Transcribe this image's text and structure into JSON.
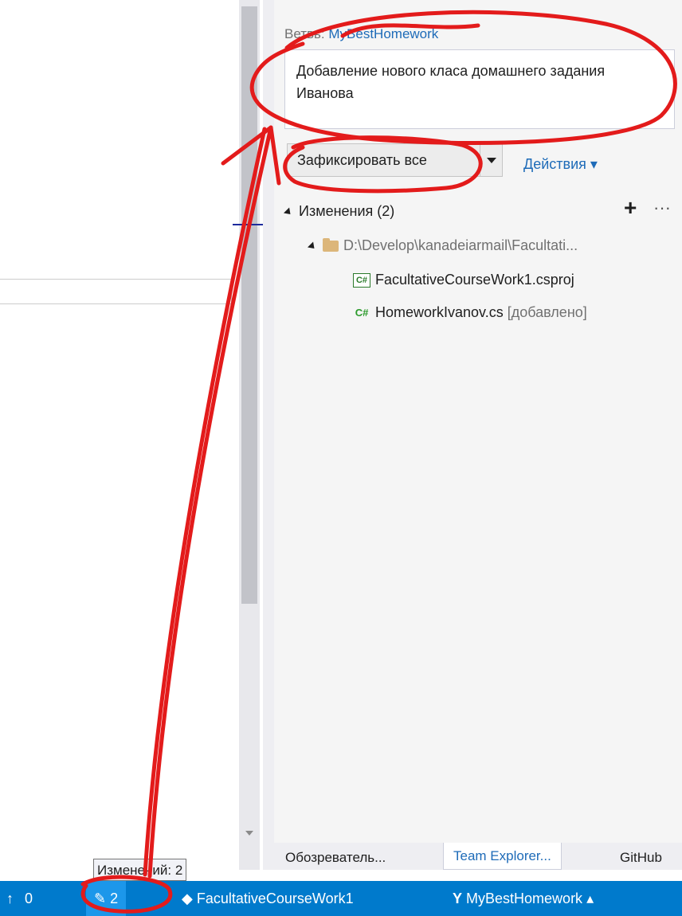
{
  "panel": {
    "branch_label": "Ветвь:",
    "branch_name": "MyBestHomework",
    "commit_message": "Добавление нового класа домашнего задания Иванова",
    "commit_button": "Зафиксировать все",
    "actions_link": "Действия ▾",
    "changes_header": "Изменения (2)",
    "add_symbol": "+",
    "more_symbol": "···",
    "folder_path": "D:\\Develop\\kanadeiarmail\\Facultati...",
    "files": [
      {
        "icon": "C#",
        "name": "FacultativeCourseWork1.csproj",
        "status": ""
      },
      {
        "icon": "C#",
        "name": "HomeworkIvanov.cs",
        "status": "[добавлено]"
      }
    ]
  },
  "tabs": [
    "Обозреватель...",
    "Team Explorer...",
    "GitHub"
  ],
  "tooltip": "Изменений: 2",
  "status_bar": {
    "up_arrow": "↑",
    "unpushed_count": "0",
    "pencil": "✎",
    "changes_count": "2",
    "repo_icon": "◆",
    "repository": "FacultativeCourseWork1",
    "branch_icon": "Y",
    "branch": "MyBestHomework ▴"
  },
  "colors": {
    "status_bar": "#007acc",
    "link": "#1e6bb8",
    "annotation": "#e31b1b"
  }
}
